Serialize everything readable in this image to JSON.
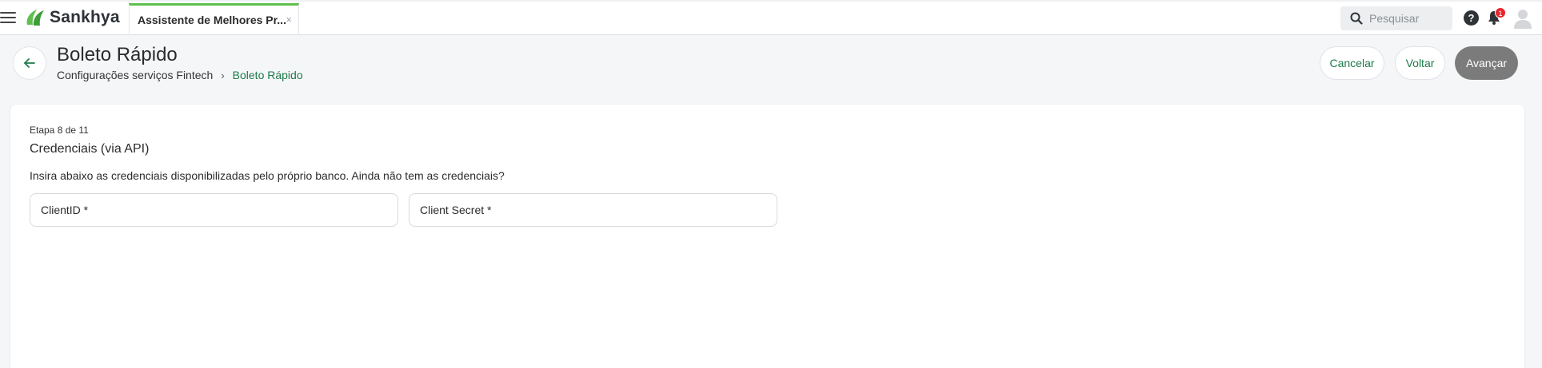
{
  "app": {
    "logo_text": "Sankhya"
  },
  "tab": {
    "label": "Assistente de Melhores Pr...",
    "close": "×"
  },
  "search": {
    "placeholder": "Pesquisar"
  },
  "header": {
    "help_glyph": "?",
    "notifications_count": "1"
  },
  "page": {
    "title": "Boleto Rápido",
    "breadcrumb": {
      "parent": "Configurações serviços Fintech",
      "separator": "›",
      "current": "Boleto Rápido"
    },
    "actions": {
      "cancel": "Cancelar",
      "back": "Voltar",
      "next": "Avançar"
    }
  },
  "wizard": {
    "step": "Etapa 8 de 11",
    "title": "Credenciais (via API)",
    "description": "Insira abaixo as credenciais disponibilizadas pelo próprio banco. Ainda não tem as credenciais?",
    "fields": [
      {
        "label": "ClientID *"
      },
      {
        "label": "Client Secret *"
      }
    ]
  },
  "colors": {
    "brand_green": "#5fbf4f",
    "link_green": "#1e7a4a",
    "primary_button": "#7b7b7b",
    "badge_red": "#e8262c"
  }
}
